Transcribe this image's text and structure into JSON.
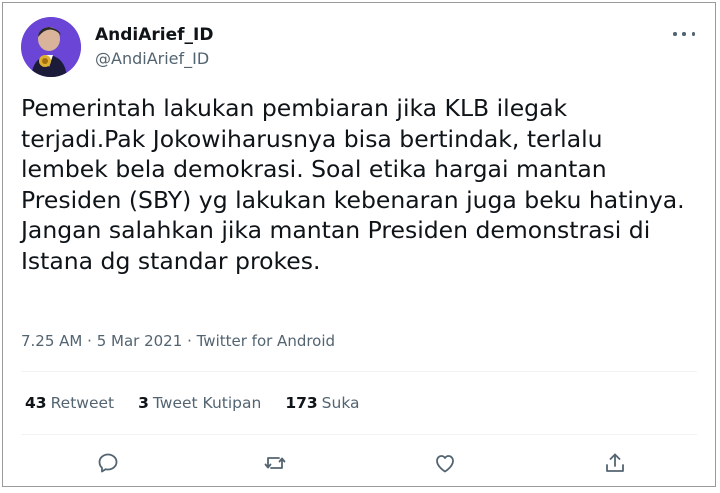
{
  "user": {
    "display_name": "AndiArief_ID",
    "handle": "@AndiArief_ID",
    "avatar_icon": "profile-photo"
  },
  "tweet": {
    "text": "Pemerintah lakukan pembiaran jika KLB ilegak\nterjadi.Pak Jokowiharusnya bisa bertindak, terlalu\nlembek bela demokrasi. Soal etika hargai mantan\nPresiden (SBY) yg lakukan kebenaran juga beku hatinya.\nJangan salahkan jika mantan Presiden demonstrasi di\nIstana dg standar prokes.",
    "time": "7.25 AM",
    "date": "5 Mar 2021",
    "source": "Twitter for Android",
    "separator": "·"
  },
  "stats": {
    "retweets": {
      "count": "43",
      "label": "Retweet"
    },
    "quotes": {
      "count": "3",
      "label": "Tweet Kutipan"
    },
    "likes": {
      "count": "173",
      "label": "Suka"
    }
  },
  "actions": [
    "reply-icon",
    "retweet-icon",
    "like-icon",
    "share-icon"
  ],
  "colors": {
    "text": "#0f1419",
    "secondary": "#536471",
    "divider": "#eff3f4"
  }
}
